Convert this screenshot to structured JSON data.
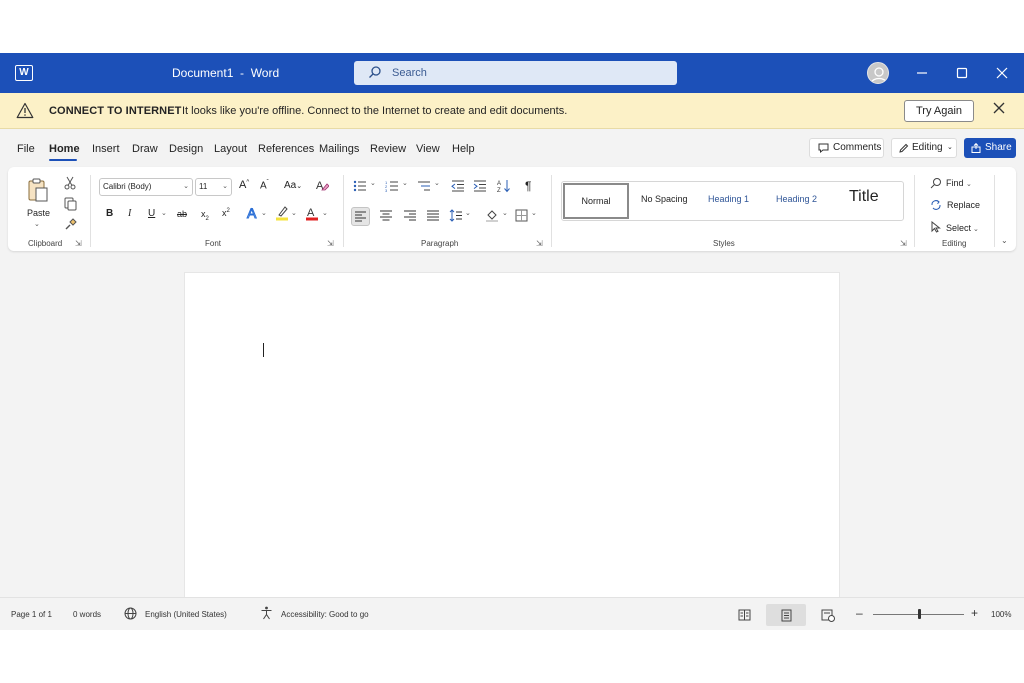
{
  "titlebar": {
    "app_icon": "word-logo",
    "app_icon_letter": "W",
    "doc_title": "Document1  -  Word",
    "search_placeholder": "Search",
    "controls": [
      "minimize-icon",
      "maximize-icon",
      "close-icon"
    ],
    "color": "#1c50b8"
  },
  "banner": {
    "title": "CONNECT TO INTERNET",
    "message": "It looks like you're offline. Connect to the Internet to create and edit documents.",
    "action": "Try Again",
    "color": "#fcf1c7"
  },
  "menu": {
    "tabs": [
      "File",
      "Home",
      "Insert",
      "Draw",
      "Design",
      "Layout",
      "References",
      "Mailings",
      "Review",
      "View",
      "Help"
    ],
    "active_tab": "Home",
    "comments_label": "Comments",
    "editing_label": "Editing",
    "share_label": "Share"
  },
  "ribbon": {
    "clipboard": {
      "label": "Clipboard",
      "paste_label": "Paste"
    },
    "font": {
      "label": "Font",
      "family": "Calibri (Body)",
      "size": "11",
      "change_case": "Aa"
    },
    "paragraph": {
      "label": "Paragraph"
    },
    "styles": {
      "label": "Styles",
      "items": [
        "Normal",
        "No Spacing",
        "Heading 1",
        "Heading 2",
        "Title"
      ],
      "selected": "Normal",
      "heading_color": "#2f5597"
    },
    "editing": {
      "label": "Editing",
      "find": "Find",
      "replace": "Replace",
      "select": "Select"
    }
  },
  "statusbar": {
    "page": "Page 1 of 1",
    "words": "0 words",
    "language": "English (United States)",
    "accessibility": "Accessibility: Good to go",
    "zoom": "100%",
    "zoom_level": 0.5,
    "active_view": "print-layout"
  }
}
